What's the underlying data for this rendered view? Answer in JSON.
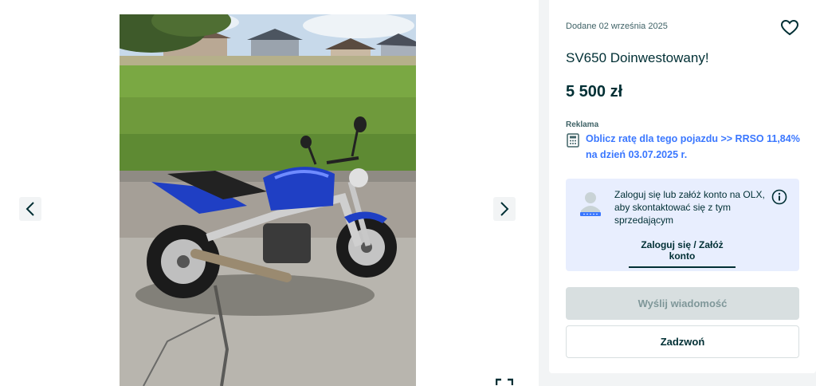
{
  "listing": {
    "added": "Dodane 02 września 2025",
    "title": "SV650 Doinwestowany!",
    "price": "5 500 zł"
  },
  "ad": {
    "label": "Reklama",
    "link": "Oblicz ratę dla tego pojazdu >> RRSO 11,84% na dzień 03.07.2025 r."
  },
  "login": {
    "message": "Zaloguj się lub załóż konto na OLX, aby skontaktować się z tym sprzedającym",
    "link": "Zaloguj się / Załóż konto"
  },
  "actions": {
    "message_button": "Wyślij wiadomość",
    "call_button": "Zadzwoń"
  },
  "icons": {
    "prev": "chevron-left-icon",
    "next": "chevron-right-icon",
    "favorite": "heart-icon",
    "calculator": "calculator-icon",
    "user": "user-avatar-icon",
    "info": "info-icon",
    "expand": "fullscreen-icon"
  },
  "colors": {
    "accent_link": "#3a77ff",
    "text": "#002f34",
    "login_box": "#e8eefe",
    "disabled_button": "#d8dfe0",
    "motorcycle": "#1f3fc4"
  }
}
